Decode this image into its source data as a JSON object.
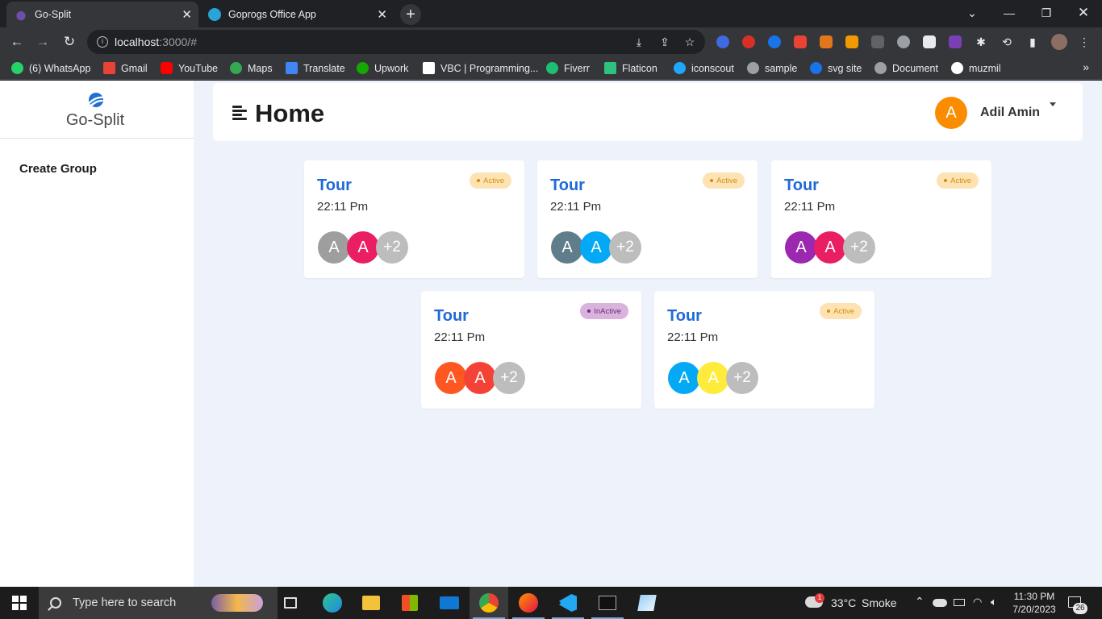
{
  "browser": {
    "tabs": [
      {
        "title": "Go-Split",
        "active": true
      },
      {
        "title": "Goprogs Office App",
        "active": false
      }
    ],
    "address": {
      "host": "localhost",
      "path": ":3000/#"
    },
    "bookmarks": [
      {
        "label": "(6) WhatsApp",
        "icon": "whatsapp-icon",
        "color": "#25d366"
      },
      {
        "label": "Gmail",
        "icon": "gmail-icon",
        "color": "#ea4335"
      },
      {
        "label": "YouTube",
        "icon": "youtube-icon",
        "color": "#ff0000"
      },
      {
        "label": "Maps",
        "icon": "maps-icon",
        "color": "#34a853"
      },
      {
        "label": "Translate",
        "icon": "translate-icon",
        "color": "#4285f4"
      },
      {
        "label": "Upwork",
        "icon": "upwork-icon",
        "color": "#14a800"
      },
      {
        "label": "VBC | Programming...",
        "icon": "vbc-icon",
        "color": "#ffffff"
      },
      {
        "label": "Fiverr",
        "icon": "fiverr-icon",
        "color": "#1dbf73"
      },
      {
        "label": "Flaticon",
        "icon": "flaticon-icon",
        "color": "#2ec27e"
      },
      {
        "label": "iconscout",
        "icon": "iconscout-icon",
        "color": "#1ea7fd"
      },
      {
        "label": "sample",
        "icon": "globe-icon",
        "color": "#9aa0a6"
      },
      {
        "label": "svg site",
        "icon": "svg-site-icon",
        "color": "#1a73e8"
      },
      {
        "label": "Document",
        "icon": "globe-icon",
        "color": "#9aa0a6"
      },
      {
        "label": "muzmil",
        "icon": "github-icon",
        "color": "#ffffff"
      }
    ]
  },
  "app": {
    "logo_text": "Go-Split",
    "sidebar": {
      "items": [
        {
          "label": "Create Group"
        }
      ]
    },
    "header": {
      "title": "Home",
      "user": {
        "initial": "A",
        "name": "Adil Amin",
        "color": "#fb8c00"
      }
    },
    "groups": [
      {
        "title": "Tour",
        "time": "22:11 Pm",
        "status": "Active",
        "members": [
          {
            "initial": "A",
            "color": "#9e9e9e"
          },
          {
            "initial": "A",
            "color": "#e91e63"
          }
        ],
        "more": "+2"
      },
      {
        "title": "Tour",
        "time": "22:11 Pm",
        "status": "Active",
        "members": [
          {
            "initial": "A",
            "color": "#607d8b"
          },
          {
            "initial": "A",
            "color": "#03a9f4"
          }
        ],
        "more": "+2"
      },
      {
        "title": "Tour",
        "time": "22:11 Pm",
        "status": "Active",
        "members": [
          {
            "initial": "A",
            "color": "#9c27b0"
          },
          {
            "initial": "A",
            "color": "#e91e63"
          }
        ],
        "more": "+2"
      },
      {
        "title": "Tour",
        "time": "22:11 Pm",
        "status": "InActive",
        "members": [
          {
            "initial": "A",
            "color": "#ff5722"
          },
          {
            "initial": "A",
            "color": "#f44336"
          }
        ],
        "more": "+2"
      },
      {
        "title": "Tour",
        "time": "22:11 Pm",
        "status": "Active",
        "members": [
          {
            "initial": "A",
            "color": "#03a9f4"
          },
          {
            "initial": "A",
            "color": "#ffeb3b"
          }
        ],
        "more": "+2"
      }
    ]
  },
  "taskbar": {
    "search_placeholder": "Type here to search",
    "weather": {
      "temp": "33°C",
      "condition": "Smoke",
      "alert_count": "1"
    },
    "time": "11:30 PM",
    "date": "7/20/2023",
    "notifications": "26"
  }
}
